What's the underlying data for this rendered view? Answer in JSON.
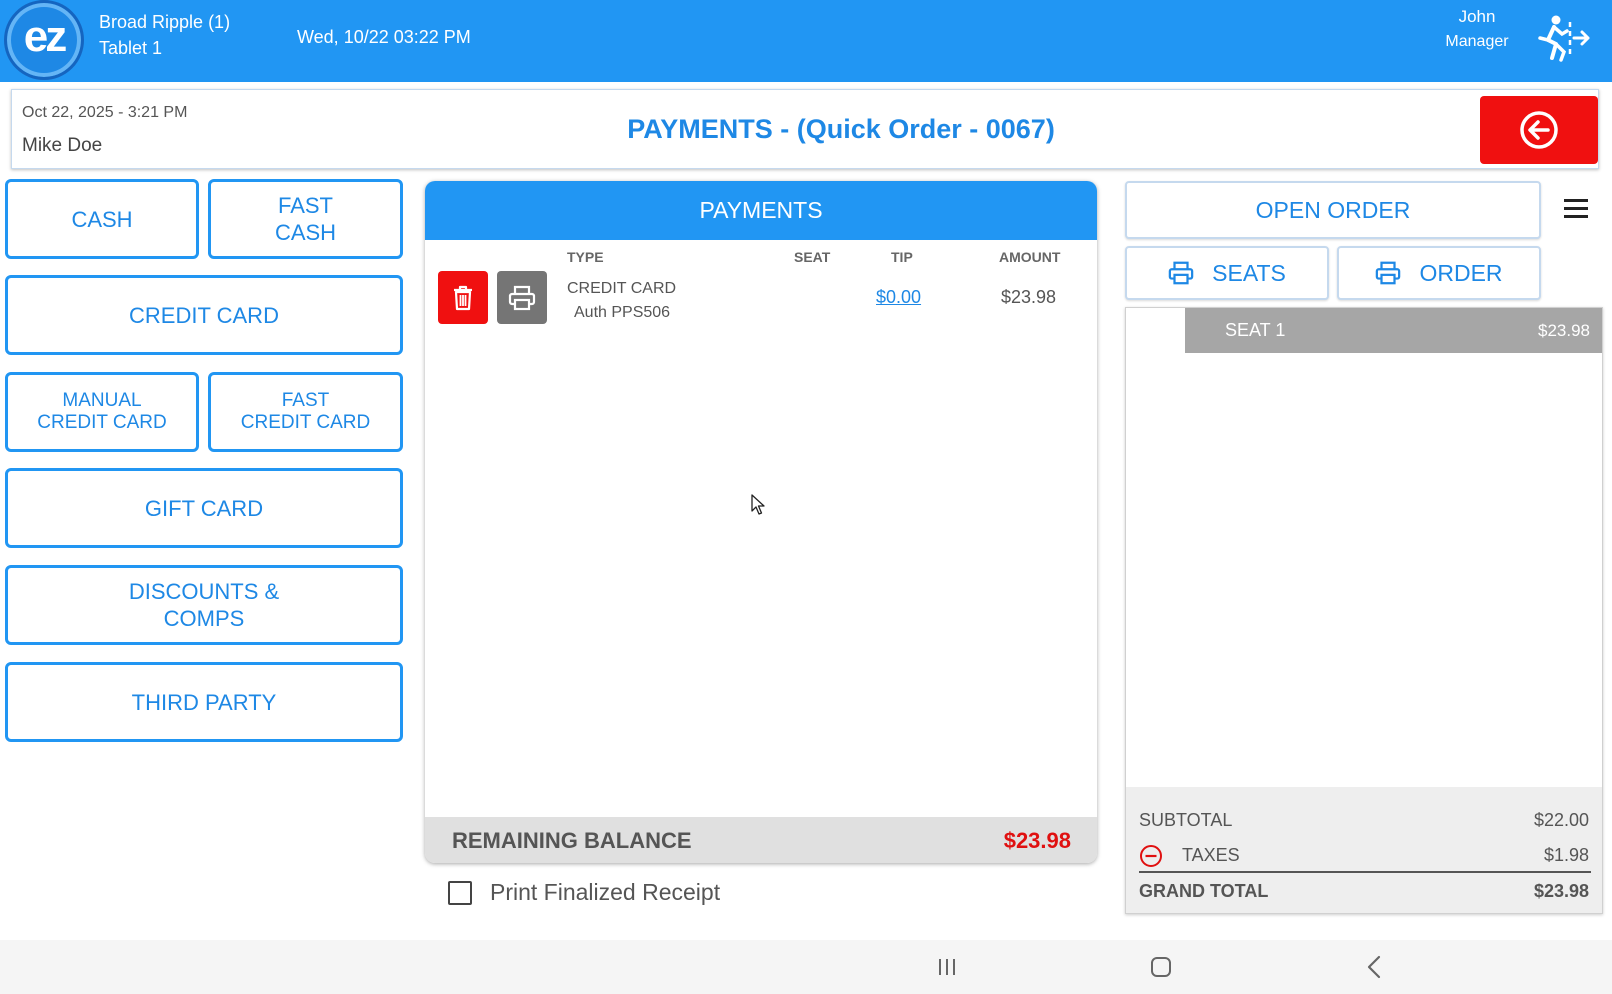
{
  "topbar": {
    "logo_text": "ez",
    "location": "Broad Ripple (1)",
    "device": "Tablet 1",
    "datetime": "Wed, 10/22 03:22 PM",
    "user_name": "John",
    "user_role": "Manager",
    "exit_icon": "logout-icon"
  },
  "header": {
    "order_date": "Oct 22, 2025  - 3:21 PM",
    "customer": "Mike Doe",
    "title": "PAYMENTS - (Quick Order - 0067)",
    "back_icon": "back-arrow-icon"
  },
  "payment_methods": {
    "cash": "CASH",
    "fast_cash": "FAST\nCASH",
    "credit_card": "CREDIT CARD",
    "manual_credit_card": "MANUAL\nCREDIT CARD",
    "fast_credit_card": "FAST\nCREDIT CARD",
    "gift_card": "GIFT CARD",
    "discounts": "DISCOUNTS &\nCOMPS",
    "third_party": "THIRD PARTY"
  },
  "payments": {
    "title": "PAYMENTS",
    "columns": [
      "TYPE",
      "SEAT",
      "TIP",
      "AMOUNT"
    ],
    "rows": [
      {
        "type": "CREDIT CARD",
        "auth": "Auth PPS506",
        "seat": "",
        "tip": "$0.00",
        "amount": "$23.98"
      }
    ],
    "remaining_label": "REMAINING BALANCE",
    "remaining_value": "$23.98",
    "accent_color": "#2196f3",
    "alert_color": "#e01010"
  },
  "print_receipt": {
    "label": "Print Finalized Receipt",
    "checked": false
  },
  "order_panel": {
    "open_order": "OPEN ORDER",
    "seats_button": "SEATS",
    "order_button": "ORDER",
    "menu_icon": "hamburger-menu-icon",
    "seats": [
      {
        "name": "SEAT 1",
        "amount": "$23.98"
      }
    ],
    "subtotal_label": "SUBTOTAL",
    "subtotal_value": "$22.00",
    "taxes_label": "TAXES",
    "taxes_value": "$1.98",
    "grand_total_label": "GRAND TOTAL",
    "grand_total_value": "$23.98"
  },
  "nav": {
    "recents_icon": "recents-icon",
    "home_icon": "home-icon",
    "back_icon": "back-icon"
  }
}
